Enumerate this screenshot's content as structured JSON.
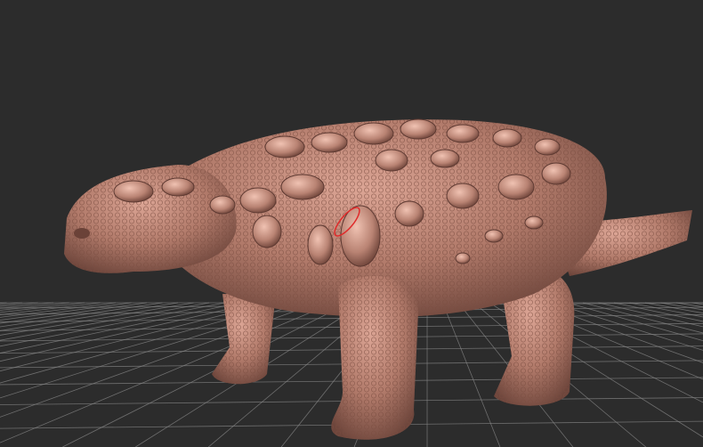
{
  "viewport": {
    "background": "#2c2c2c",
    "grid_color": "#8a8a8a",
    "model_color": "#b98373",
    "model_shadow": "#5e3a32",
    "model_highlight": "#e6b3a3",
    "brush_cursor_color": "#e02a2a"
  }
}
